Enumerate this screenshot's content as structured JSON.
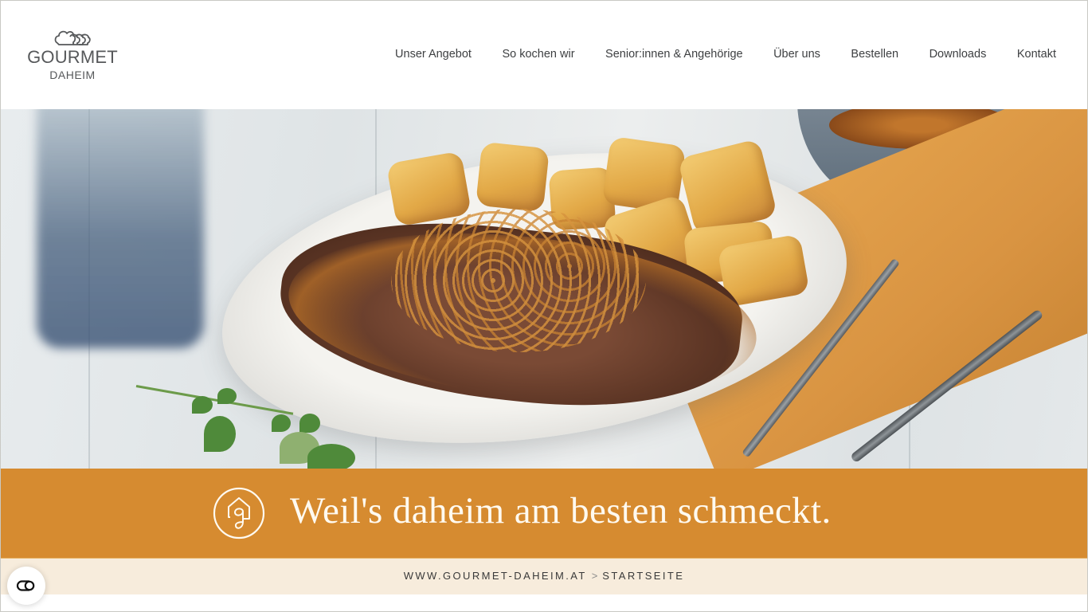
{
  "header": {
    "logo": {
      "icon": "chef-hats-icon",
      "word": "GOURMET",
      "sub": "DAHEIM"
    },
    "nav": [
      {
        "label": "Unser Angebot"
      },
      {
        "label": "So kochen wir"
      },
      {
        "label": "Senior:innen & Angehörige"
      },
      {
        "label": "Über uns"
      },
      {
        "label": "Bestellen"
      },
      {
        "label": "Downloads"
      },
      {
        "label": "Kontakt"
      }
    ]
  },
  "hero": {
    "image": "steak-with-fried-onions-and-potatoes-photo"
  },
  "banner": {
    "icon": "house-g-icon",
    "text": "Weil's daheim am besten schmeckt.",
    "color": "#D68B30"
  },
  "breadcrumb": {
    "items": [
      {
        "label": "WWW.GOURMET-DAHEIM.AT"
      },
      {
        "label": "STARTSEITE"
      }
    ],
    "separator": ">",
    "background": "#F7ECDC"
  },
  "floating_button": {
    "icon": "toggle-icon"
  }
}
